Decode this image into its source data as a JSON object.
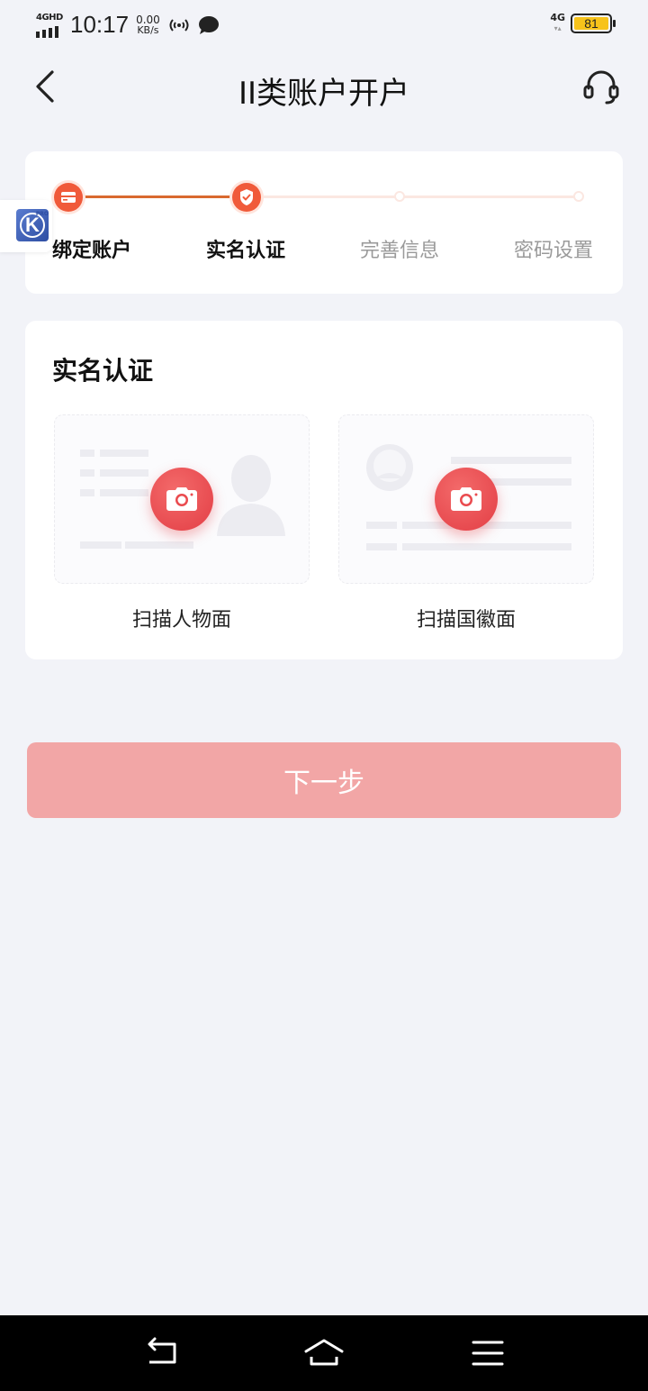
{
  "status_bar": {
    "network_label": "4GHD",
    "time": "10:17",
    "speed_value": "0.00",
    "speed_unit": "KB/s",
    "network_right": "4G",
    "battery": "81"
  },
  "header": {
    "title": "II类账户开户",
    "back_icon": "chevron-left-icon",
    "service_icon": "headset-icon"
  },
  "steps": [
    {
      "label": "绑定账户",
      "state": "done",
      "icon": "card-icon"
    },
    {
      "label": "实名认证",
      "state": "current",
      "icon": "shield-check-icon"
    },
    {
      "label": "完善信息",
      "state": "pending"
    },
    {
      "label": "密码设置",
      "state": "pending"
    }
  ],
  "verify": {
    "title": "实名认证",
    "front_caption": "扫描人物面",
    "back_caption": "扫描国徽面"
  },
  "next_button": "下一步",
  "colors": {
    "accent": "#f05a3a",
    "progress_done": "#d9692f",
    "button_disabled": "#f2a6a6",
    "background": "#f2f3f8"
  }
}
